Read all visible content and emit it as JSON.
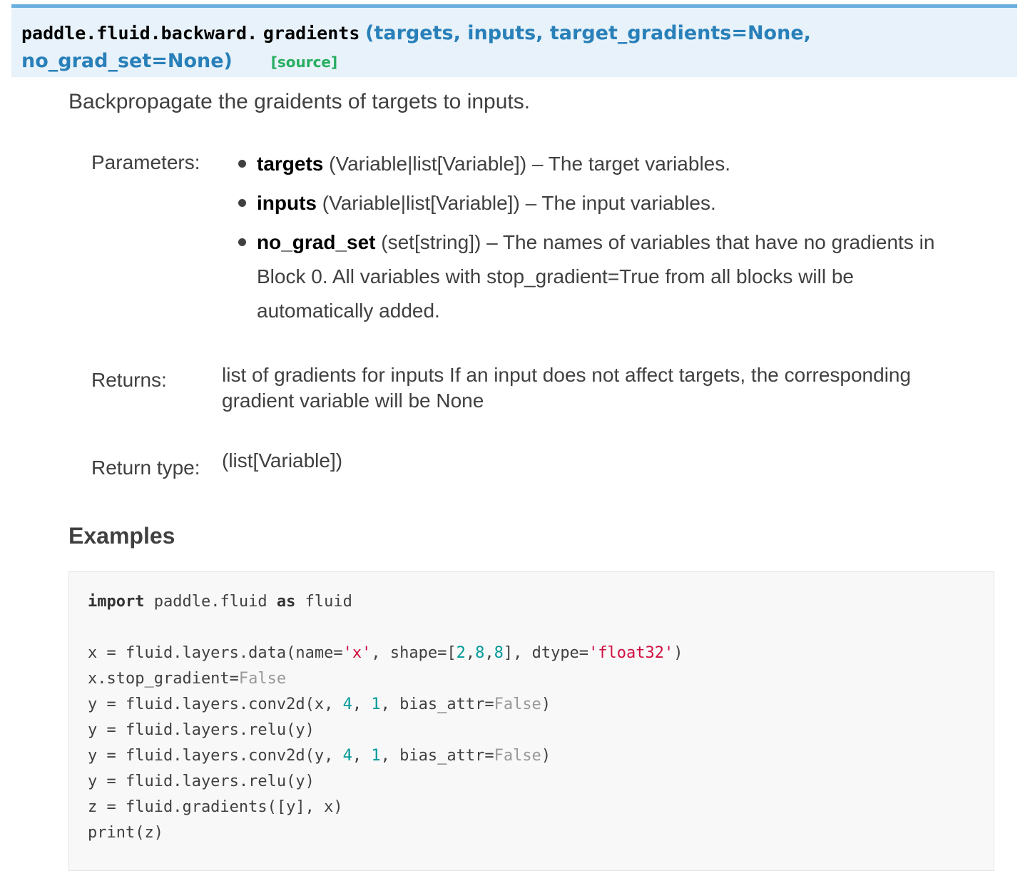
{
  "signature": {
    "prename": "paddle.fluid.backward.",
    "name": "gradients",
    "params_line1": "(targets, inputs, target_gradients=None,",
    "params_line2": "no_grad_set=None)",
    "source_link": "[source]"
  },
  "description": "Backpropagate the graidents of targets to inputs.",
  "fields": {
    "parameters_label": "Parameters:",
    "parameters": [
      {
        "name": "targets",
        "text": " (Variable|list[Variable]) – The target variables."
      },
      {
        "name": "inputs",
        "text": " (Variable|list[Variable]) – The input variables."
      },
      {
        "name": "no_grad_set",
        "text": " (set[string]) – The names of variables that have no gradients in Block 0. All variables with stop_gradient=True from all blocks will be automatically added."
      }
    ],
    "returns_label": "Returns:",
    "returns_text": "list of gradients for inputs If an input does not affect targets, the corresponding gradient variable will be None",
    "return_type_label": "Return type:",
    "return_type_text": "(list[Variable])"
  },
  "examples": {
    "title": "Examples",
    "code": {
      "l1_kw1": "import",
      "l1_mid": " paddle.fluid ",
      "l1_kw2": "as",
      "l1_end": " fluid",
      "l3_a": "x = fluid.layers.data(name=",
      "l3_s1": "'x'",
      "l3_b": ", shape=[",
      "l3_n1": "2",
      "l3_c1": ",",
      "l3_n2": "8",
      "l3_c2": ",",
      "l3_n3": "8",
      "l3_d": "], dtype=",
      "l3_s2": "'float32'",
      "l3_e": ")",
      "l4_a": "x.stop_gradient=",
      "l4_k": "False",
      "l5_a": "y = fluid.layers.conv2d(x, ",
      "l5_n1": "4",
      "l5_b": ", ",
      "l5_n2": "1",
      "l5_c": ", bias_attr=",
      "l5_k": "False",
      "l5_d": ")",
      "l6": "y = fluid.layers.relu(y)",
      "l7_a": "y = fluid.layers.conv2d(y, ",
      "l7_n1": "4",
      "l7_b": ", ",
      "l7_n2": "1",
      "l7_c": ", bias_attr=",
      "l7_k": "False",
      "l7_d": ")",
      "l8": "y = fluid.layers.relu(y)",
      "l9": "z = fluid.gradients([y], x)",
      "l10": "print(z)"
    }
  },
  "colors": {
    "signature_bg": "#e7f2fa",
    "signature_border": "#6ab0de",
    "param_blue": "#2980b9",
    "source_green": "#27ae60",
    "string_red": "#d01040",
    "number_teal": "#009999",
    "constant_gray": "#999999"
  }
}
